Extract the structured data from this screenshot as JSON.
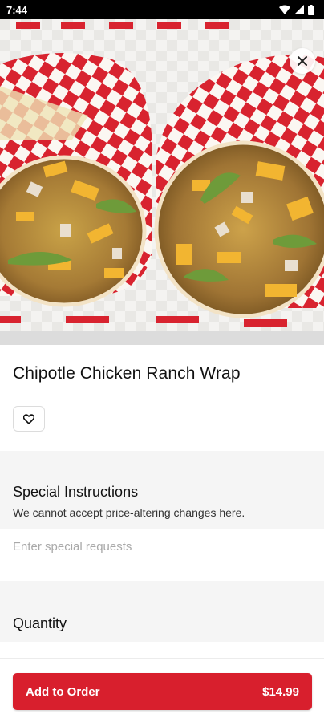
{
  "status_bar": {
    "time": "7:44"
  },
  "hero": {
    "image": "chipotle-chicken-ranch-wrap-photo"
  },
  "item": {
    "title": "Chipotle Chicken Ranch Wrap"
  },
  "special_instructions": {
    "title": "Special Instructions",
    "subtitle": "We cannot accept price-altering changes here.",
    "placeholder": "Enter special requests",
    "value": ""
  },
  "quantity": {
    "title": "Quantity"
  },
  "order_button": {
    "label": "Add to Order",
    "price": "$14.99"
  },
  "colors": {
    "accent": "#d81f2d",
    "band": "#f5f5f5"
  },
  "icons": [
    "wifi-icon",
    "signal-icon",
    "battery-icon",
    "close-icon",
    "heart-icon"
  ]
}
